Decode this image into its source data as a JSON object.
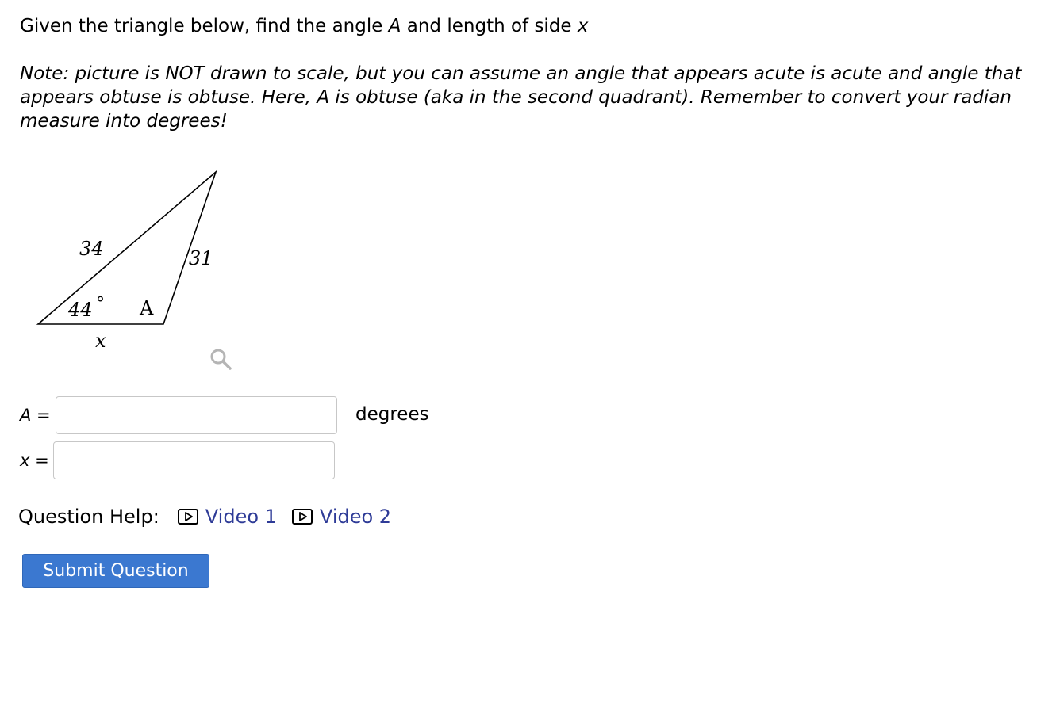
{
  "question": {
    "prompt_part1": "Given the triangle below, find the angle ",
    "prompt_var_a": "A",
    "prompt_part2": " and length of side ",
    "prompt_var_x": "x",
    "note": "Note: picture is NOT drawn to scale, but you can assume an angle that appears acute is acute and angle that appears obtuse is obtuse. Here, A is obtuse (aka in the second quadrant). Remember to convert your radian measure into degrees!"
  },
  "figure": {
    "side_left": "34",
    "side_right": "31",
    "angle_given": "44",
    "degree_symbol": "°",
    "angle_unknown": "A",
    "side_bottom": "x"
  },
  "answers": {
    "a_label": "A",
    "a_equals": " =",
    "a_value": "",
    "a_unit": "degrees",
    "x_label": "x",
    "x_equals": " =",
    "x_value": ""
  },
  "help": {
    "label": "Question Help:",
    "video1": "Video 1",
    "video2": "Video 2"
  },
  "submit_label": "Submit Question",
  "colors": {
    "link": "#2e3b97",
    "button": "#3b78d0",
    "input_border": "#c7c7c7"
  }
}
